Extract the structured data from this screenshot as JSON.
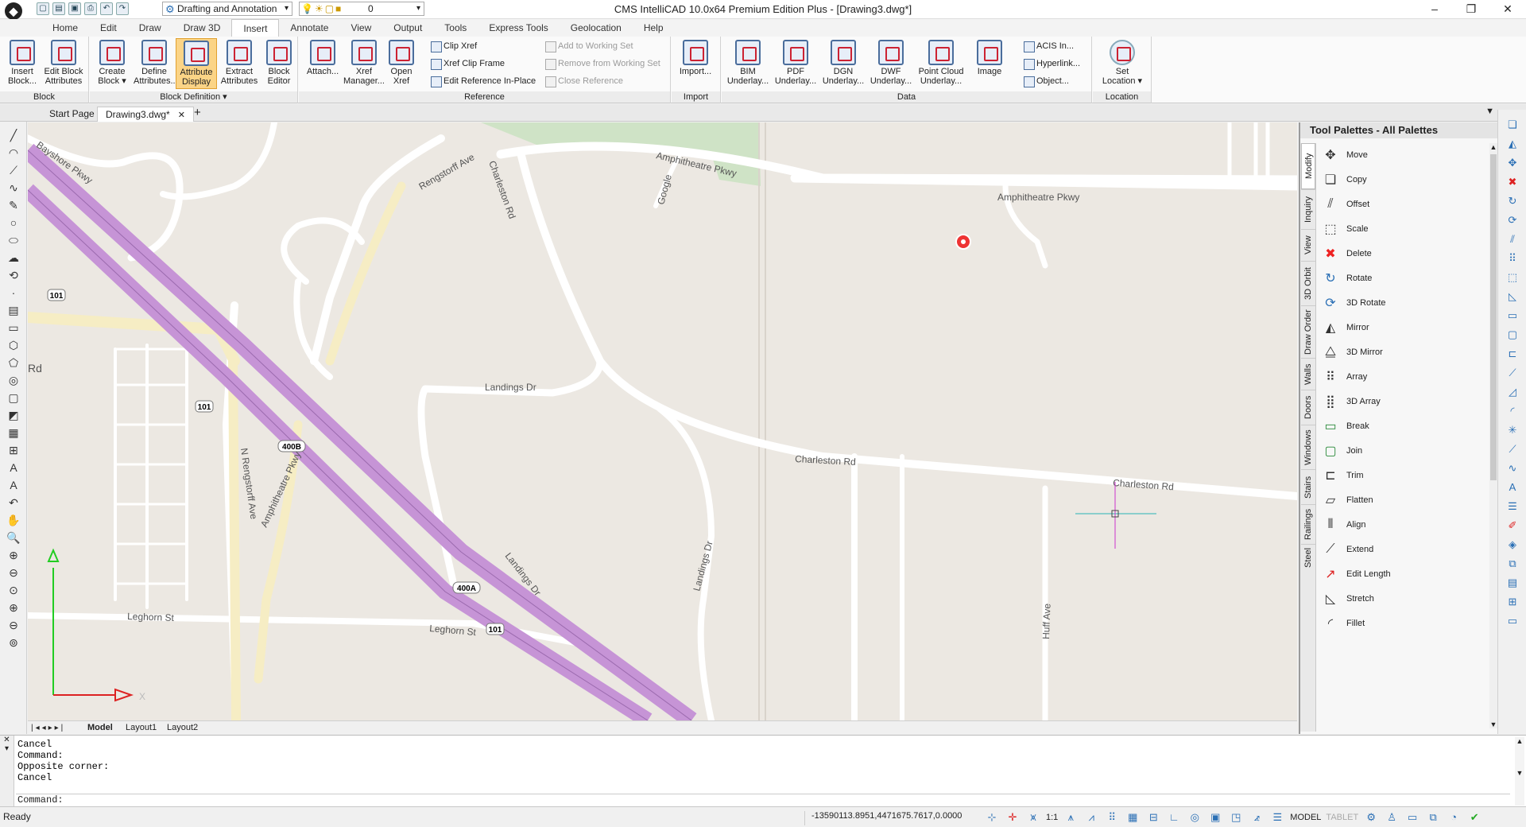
{
  "titlebar": {
    "title": "CMS IntelliCAD 10.0x64 Premium Edition Plus - [Drawing3.dwg*]",
    "workspace": "Drafting and Annotation",
    "layer": "0",
    "qat_icons": [
      "new-icon",
      "open-icon",
      "save-icon",
      "print-icon",
      "undo-icon",
      "redo-icon"
    ]
  },
  "menu": [
    "Home",
    "Edit",
    "Draw",
    "Draw 3D",
    "Insert",
    "Annotate",
    "View",
    "Output",
    "Tools",
    "Express Tools",
    "Geolocation",
    "Help"
  ],
  "menu_active": "Insert",
  "ribbon": {
    "block": {
      "title": "Block",
      "insert": "Insert Block...",
      "edit": "Edit Block Attributes"
    },
    "block_def": {
      "title": "Block Definition ▾",
      "create": "Create Block ▾",
      "define": "Define Attributes...",
      "attr_display": "Attribute Display",
      "extract": "Extract Attributes",
      "editor": "Block Editor"
    },
    "reference": {
      "title": "Reference",
      "attach": "Attach...",
      "xref_mgr": "Xref Manager...",
      "open_xref": "Open Xref",
      "clip_xref": "Clip Xref",
      "xref_clip_frame": "Xref Clip Frame",
      "edit_ref": "Edit Reference In-Place",
      "add_ws": "Add to Working Set",
      "remove_ws": "Remove from Working Set",
      "close_ref": "Close Reference"
    },
    "import": {
      "title": "Import",
      "import": "Import..."
    },
    "data": {
      "title": "Data",
      "bim": "BIM Underlay...",
      "pdf": "PDF Underlay...",
      "dgn": "DGN Underlay...",
      "dwf": "DWF Underlay...",
      "pointcloud": "Point Cloud Underlay...",
      "image": "Image",
      "acis": "ACIS In...",
      "hyperlink": "Hyperlink...",
      "object": "Object..."
    },
    "location": {
      "title": "Location",
      "set": "Set Location ▾"
    }
  },
  "doc_tabs": {
    "start": "Start Page",
    "drawing": "Drawing3.dwg*"
  },
  "map": {
    "labels": {
      "bayshore": "Bayshore Pkwy",
      "rengstorff_ave": "Rengstorff Ave",
      "charleston_rd_v": "Charleston Rd",
      "amphitheatre_top": "Amphitheatre Pkwy",
      "amphitheatre_right": "Amphitheatre Pkwy",
      "google": "Google",
      "landings_dr": "Landings Dr",
      "charleston_rd_mid": "Charleston Rd",
      "charleston_rd_right": "Charleston Rd",
      "rd": "Rd",
      "n_rengstorff": "N Rengstorff Ave",
      "amphitheatre_pkwy_diag": "Amphitheatre Pkwy",
      "landings_dr_diag": "Landings Dr",
      "landings_dr_v": "Landings Dr",
      "leghorn_left": "Leghorn St",
      "leghorn_mid": "Leghorn St",
      "huff_ave": "Huff Ave"
    },
    "shields": {
      "s101a": "101",
      "s101b": "101",
      "s101c": "101",
      "s400b": "400B",
      "s400a": "400A"
    },
    "ucs": {
      "x": "X"
    }
  },
  "layout_tabs": [
    "Model",
    "Layout1",
    "Layout2"
  ],
  "palette": {
    "title": "Tool Palettes - All Palettes",
    "tabs": [
      "Modify",
      "Inquiry",
      "View",
      "3D Orbit",
      "Draw Order",
      "Walls",
      "Doors",
      "Windows",
      "Stairs",
      "Railings",
      "Steel"
    ],
    "items": [
      {
        "label": "Move",
        "icon": "move-icon"
      },
      {
        "label": "Copy",
        "icon": "copy-icon"
      },
      {
        "label": "Offset",
        "icon": "offset-icon"
      },
      {
        "label": "Scale",
        "icon": "scale-icon"
      },
      {
        "label": "Delete",
        "icon": "delete-icon"
      },
      {
        "label": "Rotate",
        "icon": "rotate-icon"
      },
      {
        "label": "3D Rotate",
        "icon": "3d-rotate-icon"
      },
      {
        "label": "Mirror",
        "icon": "mirror-icon"
      },
      {
        "label": "3D Mirror",
        "icon": "3d-mirror-icon"
      },
      {
        "label": "Array",
        "icon": "array-icon"
      },
      {
        "label": "3D Array",
        "icon": "3d-array-icon"
      },
      {
        "label": "Break",
        "icon": "break-icon"
      },
      {
        "label": "Join",
        "icon": "join-icon"
      },
      {
        "label": "Trim",
        "icon": "trim-icon"
      },
      {
        "label": "Flatten",
        "icon": "flatten-icon"
      },
      {
        "label": "Align",
        "icon": "align-icon"
      },
      {
        "label": "Extend",
        "icon": "extend-icon"
      },
      {
        "label": "Edit Length",
        "icon": "edit-length-icon"
      },
      {
        "label": "Stretch",
        "icon": "stretch-icon"
      },
      {
        "label": "Fillet",
        "icon": "fillet-icon"
      }
    ]
  },
  "command": {
    "history": [
      "Cancel",
      "Command:",
      "Opposite corner:",
      "Cancel"
    ],
    "prompt": "Command:"
  },
  "status": {
    "ready": "Ready",
    "coords": "-13590113.8951,4471675.7617,0.0000",
    "scale": "1:1",
    "model": "MODEL",
    "tablet": "TABLET"
  },
  "colors": {
    "highway": "#c694d6",
    "road": "#ffffff",
    "map_bg": "#ece8e2",
    "green": "#cfe3c6",
    "accent": "#2a6fb5"
  }
}
